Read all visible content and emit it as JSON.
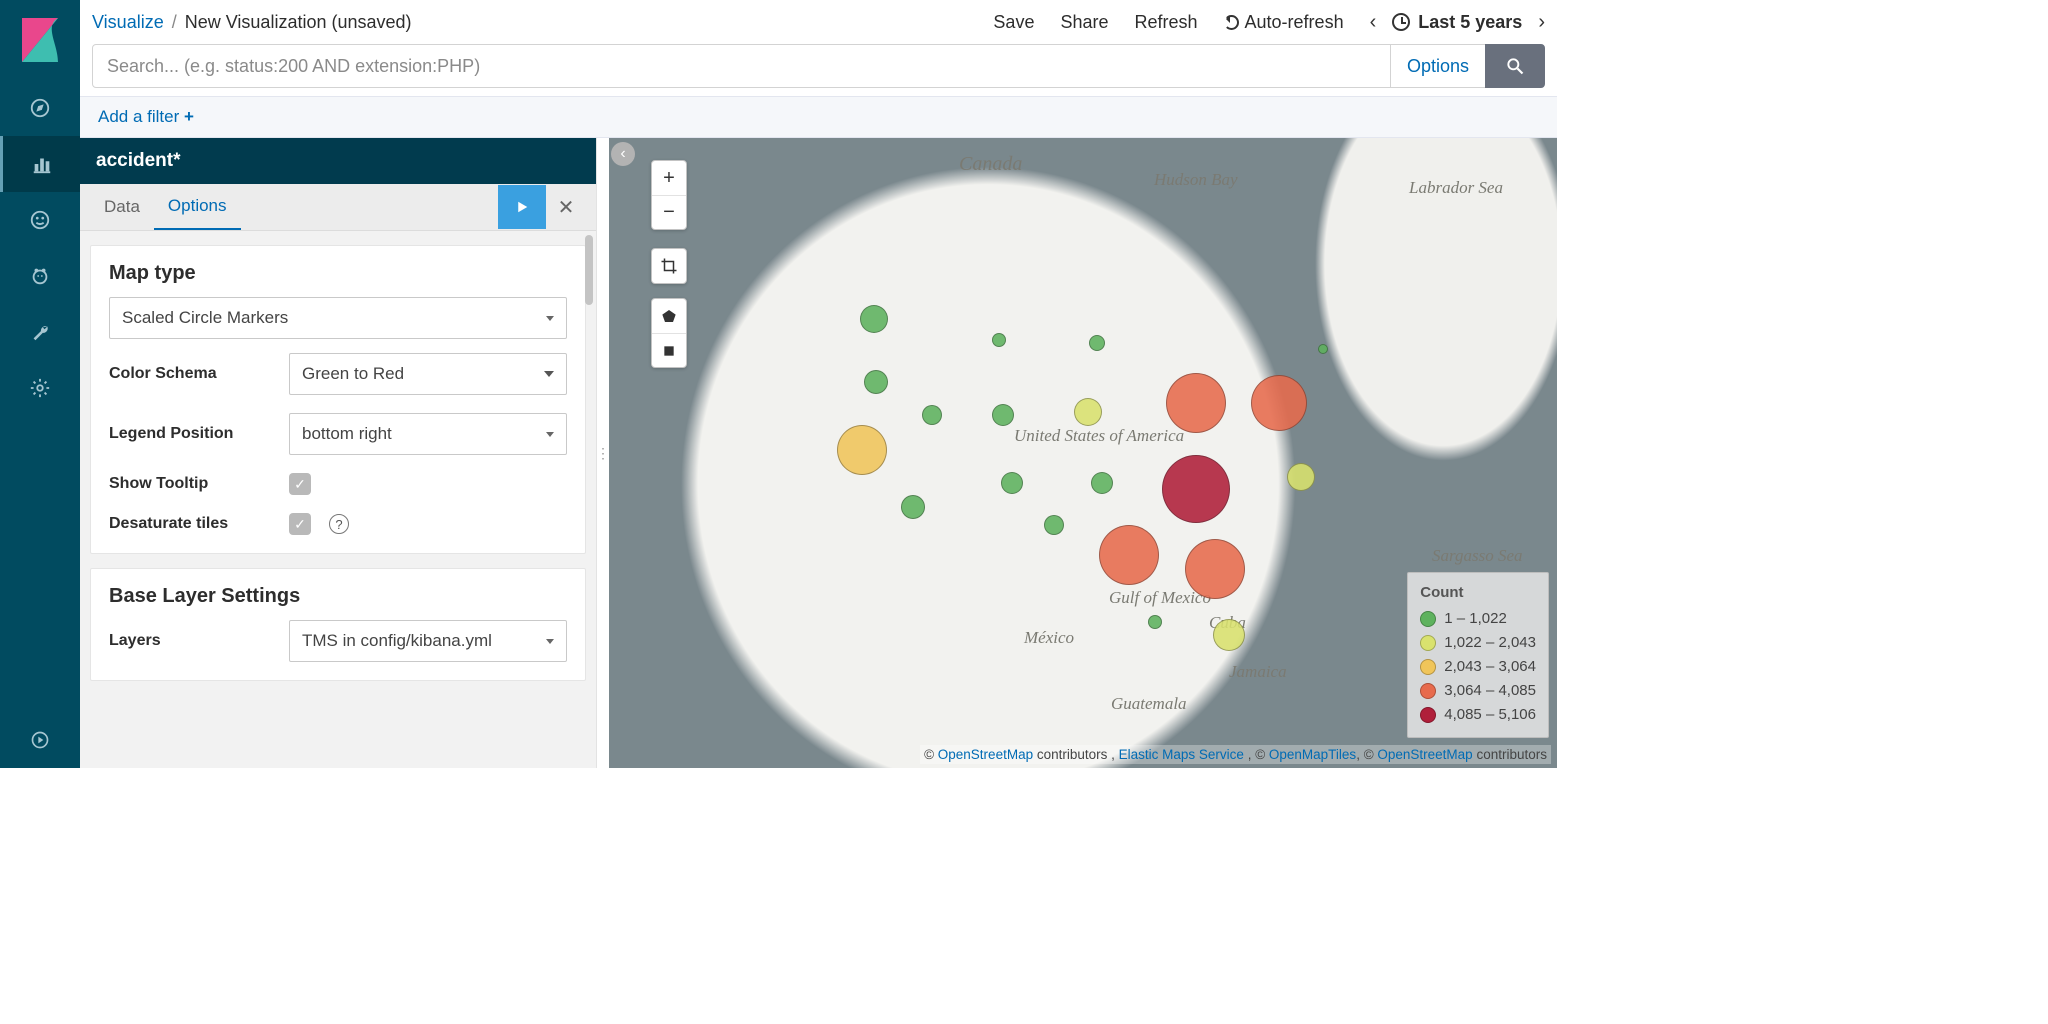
{
  "breadcrumb": {
    "root": "Visualize",
    "current": "New Visualization (unsaved)"
  },
  "toolbar": {
    "save": "Save",
    "share": "Share",
    "refresh": "Refresh",
    "auto_refresh": "Auto-refresh",
    "range": "Last 5 years"
  },
  "search": {
    "placeholder": "Search... (e.g. status:200 AND extension:PHP)",
    "options": "Options"
  },
  "filter": {
    "add": "Add a filter"
  },
  "index_pattern": "accident*",
  "tabs": {
    "data": "Data",
    "options": "Options"
  },
  "options": {
    "map_type_label": "Map type",
    "map_type_value": "Scaled Circle Markers",
    "color_schema_label": "Color Schema",
    "color_schema_value": "Green to Red",
    "legend_pos_label": "Legend Position",
    "legend_pos_value": "bottom right",
    "show_tooltip_label": "Show Tooltip",
    "desaturate_label": "Desaturate tiles",
    "base_layer_heading": "Base Layer Settings",
    "layers_label": "Layers",
    "layers_value": "TMS in config/kibana.yml"
  },
  "map": {
    "labels": {
      "canada": "Canada",
      "hudson": "Hudson\nBay",
      "labsea": "Labrador\nSea",
      "usa": "United States\nof America",
      "gulfmex": "Gulf of\nMexico",
      "sargasso": "Sargasso\nSea",
      "mexico": "México",
      "guatemala": "Guatemala",
      "cuba": "Cuba",
      "jamaica": "Jamaica"
    },
    "legend_title": "Count",
    "buckets": [
      {
        "label": "1 – 1,022",
        "color": "#5eb25e"
      },
      {
        "label": "1,022 – 2,043",
        "color": "#d9e26e"
      },
      {
        "label": "2,043 – 3,064",
        "color": "#f0c55a"
      },
      {
        "label": "3,064 – 4,085",
        "color": "#e76b4d"
      },
      {
        "label": "4,085 – 5,106",
        "color": "#b01f3a"
      }
    ],
    "points": [
      {
        "x": 26.0,
        "y": 30.5,
        "r": 14,
        "c": "#5eb25e"
      },
      {
        "x": 26.2,
        "y": 41.0,
        "r": 12,
        "c": "#5eb25e"
      },
      {
        "x": 24.8,
        "y": 52.5,
        "r": 25,
        "c": "#f0c55a"
      },
      {
        "x": 29.8,
        "y": 62.0,
        "r": 12,
        "c": "#5eb25e"
      },
      {
        "x": 31.7,
        "y": 46.5,
        "r": 10,
        "c": "#5eb25e"
      },
      {
        "x": 38.2,
        "y": 34.0,
        "r": 7,
        "c": "#5eb25e"
      },
      {
        "x": 38.6,
        "y": 46.5,
        "r": 11,
        "c": "#5eb25e"
      },
      {
        "x": 39.5,
        "y": 58.0,
        "r": 11,
        "c": "#5eb25e"
      },
      {
        "x": 43.6,
        "y": 65.0,
        "r": 10,
        "c": "#5eb25e"
      },
      {
        "x": 47.8,
        "y": 34.5,
        "r": 8,
        "c": "#5eb25e"
      },
      {
        "x": 47.0,
        "y": 46.0,
        "r": 14,
        "c": "#d9e26e"
      },
      {
        "x": 48.3,
        "y": 58.0,
        "r": 11,
        "c": "#5eb25e"
      },
      {
        "x": 51.0,
        "y": 70.0,
        "r": 30,
        "c": "#e76b4d"
      },
      {
        "x": 53.5,
        "y": 81.4,
        "r": 7,
        "c": "#5eb25e"
      },
      {
        "x": 57.5,
        "y": 44.5,
        "r": 30,
        "c": "#e76b4d"
      },
      {
        "x": 57.5,
        "y": 59.0,
        "r": 34,
        "c": "#b01f3a"
      },
      {
        "x": 59.4,
        "y": 72.5,
        "r": 30,
        "c": "#e76b4d"
      },
      {
        "x": 60.8,
        "y": 83.5,
        "r": 16,
        "c": "#d9e26e"
      },
      {
        "x": 65.7,
        "y": 44.5,
        "r": 28,
        "c": "#e76b4d"
      },
      {
        "x": 67.8,
        "y": 57.0,
        "r": 14,
        "c": "#d9e26e"
      },
      {
        "x": 70.0,
        "y": 35.5,
        "r": 5,
        "c": "#5eb25e"
      }
    ],
    "attribution": {
      "p1": "© ",
      "a1": "OpenStreetMap",
      "p2": " contributors , ",
      "a2": "Elastic Maps Service",
      "p3": " , © ",
      "a3": "OpenMapTiles",
      "p4": ", © ",
      "a4": "OpenStreetMap",
      "p5": " contributors"
    }
  }
}
